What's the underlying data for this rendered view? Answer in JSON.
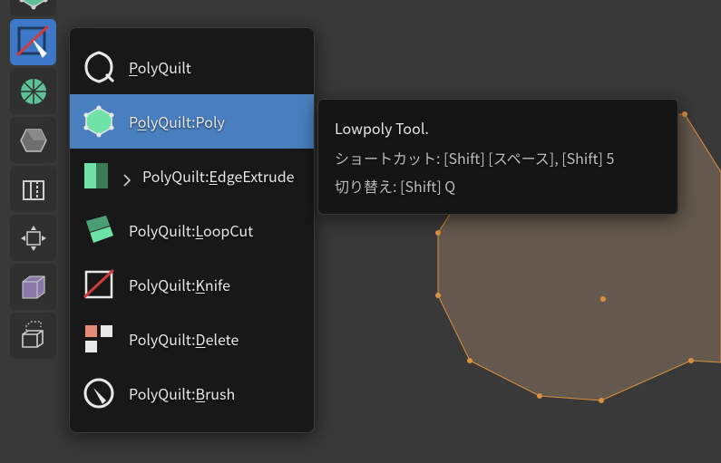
{
  "toolbar": {
    "items": [
      {
        "name": "poly-tool",
        "active": false
      },
      {
        "name": "polyquilt-tool",
        "active": true
      },
      {
        "name": "spin-tool",
        "active": false
      },
      {
        "name": "solid-tool",
        "active": false
      },
      {
        "name": "cube-tool",
        "active": false
      },
      {
        "name": "transform-tool",
        "active": false
      },
      {
        "name": "bevel-tool",
        "active": false
      },
      {
        "name": "extrude-tool",
        "active": false
      }
    ]
  },
  "flyout": {
    "items": [
      {
        "label_pre": "",
        "label_u": "P",
        "label_post": "olyQuilt",
        "selected": false,
        "icon": "polyquilt-icon"
      },
      {
        "label_pre": "P",
        "label_u": "o",
        "label_post": "lyQuilt:Poly",
        "selected": true,
        "icon": "poly-icon"
      },
      {
        "label_pre": "PolyQuilt:",
        "label_u": "E",
        "label_post": "dgeExtrude",
        "selected": false,
        "icon": "edgeextrude-icon",
        "expand": true
      },
      {
        "label_pre": "PolyQuilt:",
        "label_u": "L",
        "label_post": "oopCut",
        "selected": false,
        "icon": "loopcut-icon"
      },
      {
        "label_pre": "PolyQuilt:",
        "label_u": "K",
        "label_post": "nife",
        "selected": false,
        "icon": "knife-icon"
      },
      {
        "label_pre": "PolyQuilt:",
        "label_u": "D",
        "label_post": "elete",
        "selected": false,
        "icon": "delete-icon"
      },
      {
        "label_pre": "PolyQuilt:",
        "label_u": "B",
        "label_post": "rush",
        "selected": false,
        "icon": "brush-icon"
      }
    ]
  },
  "tooltip": {
    "title": "Lowpoly Tool.",
    "shortcut": "ショートカット: [Shift] [スペース], [Shift] 5",
    "alt": "切り替え: [Shift] Q"
  }
}
